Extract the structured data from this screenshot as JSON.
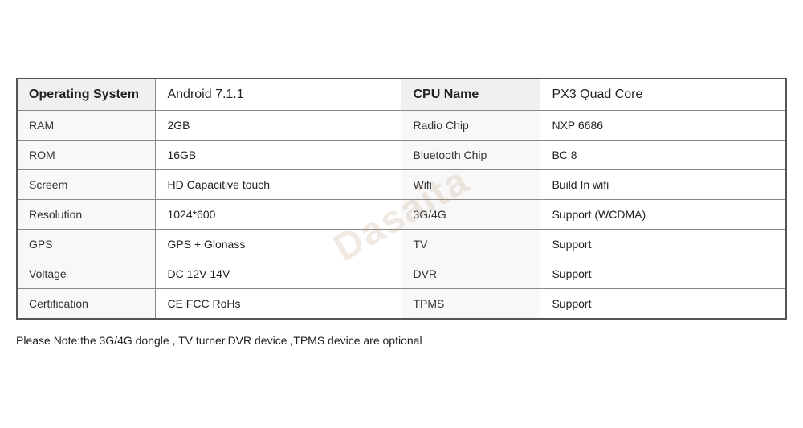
{
  "table": {
    "headers": {
      "left_label": "Operating System",
      "left_value": "Android 7.1.1",
      "right_label": "CPU Name",
      "right_value": "PX3 Quad Core"
    },
    "rows": [
      {
        "left_label": "RAM",
        "left_value": "2GB",
        "right_label": "Radio Chip",
        "right_value": "NXP 6686"
      },
      {
        "left_label": "ROM",
        "left_value": "16GB",
        "right_label": "Bluetooth Chip",
        "right_value": "BC 8"
      },
      {
        "left_label": "Screem",
        "left_value": "HD Capacitive touch",
        "right_label": "Wifi",
        "right_value": "Build In wifi"
      },
      {
        "left_label": "Resolution",
        "left_value": "1024*600",
        "right_label": "3G/4G",
        "right_value": "Support (WCDMA)"
      },
      {
        "left_label": "GPS",
        "left_value": "GPS + Glonass",
        "right_label": "TV",
        "right_value": "Support"
      },
      {
        "left_label": "Voltage",
        "left_value": "DC 12V-14V",
        "right_label": "DVR",
        "right_value": "Support"
      },
      {
        "left_label": "Certification",
        "left_value": "CE FCC RoHs",
        "right_label": "TPMS",
        "right_value": "Support"
      }
    ],
    "note": "Please Note:the 3G/4G dongle , TV turner,DVR device ,TPMS device are optional"
  },
  "watermark": "Dasaita"
}
